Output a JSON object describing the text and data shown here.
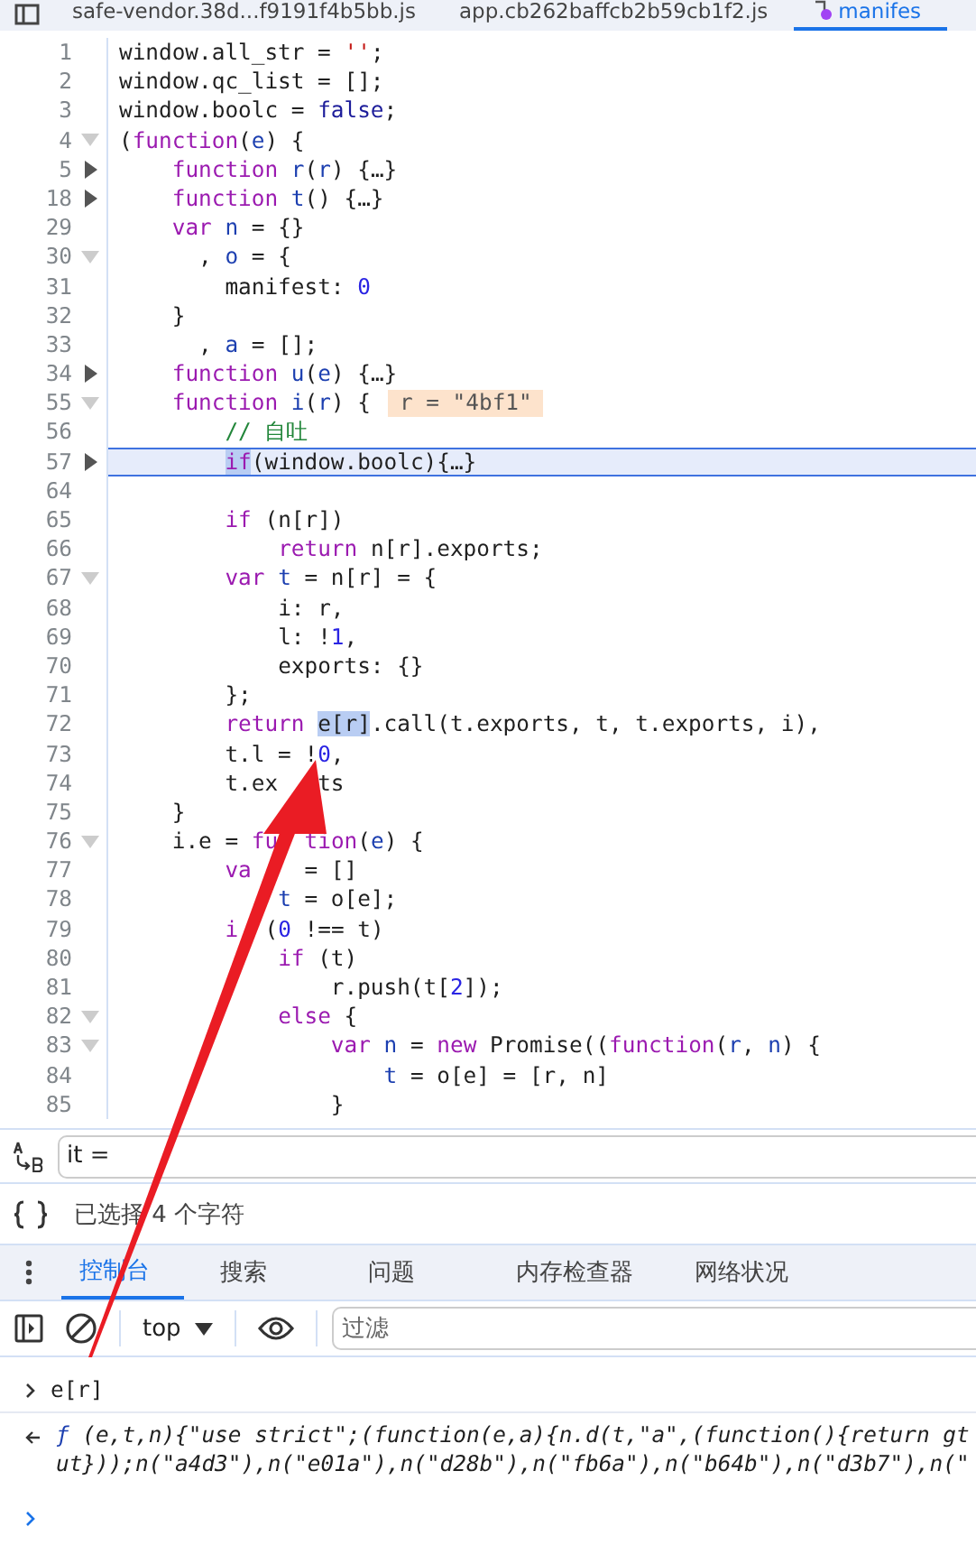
{
  "file_tabs": [
    {
      "label": "safe-vendor.38d...f9191f4b5bb.js",
      "selected": false
    },
    {
      "label": "app.cb262baffcb2b59cb1f2.js",
      "selected": false
    },
    {
      "label": "manifes",
      "selected": true
    }
  ],
  "code_lines": [
    {
      "num": "1",
      "segs": [
        {
          "t": "window.all_str = ",
          "kind": "plain"
        },
        {
          "t": "''",
          "kind": "string"
        },
        {
          "t": ";",
          "kind": "plain"
        }
      ]
    },
    {
      "num": "2",
      "segs": [
        {
          "t": "window.qc_list = [];",
          "kind": "plain"
        }
      ]
    },
    {
      "num": "3",
      "segs": [
        {
          "t": "window.boolc = ",
          "kind": "plain"
        },
        {
          "t": "false",
          "kind": "atom"
        },
        {
          "t": ";",
          "kind": "plain"
        }
      ]
    },
    {
      "num": "4",
      "expanded": true,
      "segs": [
        {
          "t": "(",
          "kind": "plain"
        },
        {
          "t": "function",
          "kind": "keyword"
        },
        {
          "t": "(",
          "kind": "plain"
        },
        {
          "t": "e",
          "kind": "var"
        },
        {
          "t": ") {",
          "kind": "plain"
        }
      ]
    },
    {
      "num": "5",
      "expanded": false,
      "segs": [
        {
          "t": "    function",
          "kind": "keyword"
        },
        {
          "t": " r",
          "kind": "var"
        },
        {
          "t": "(",
          "kind": "plain"
        },
        {
          "t": "r",
          "kind": "var"
        },
        {
          "t": ") {…}",
          "kind": "plain"
        }
      ]
    },
    {
      "num": "18",
      "expanded": false,
      "segs": [
        {
          "t": "    function",
          "kind": "keyword"
        },
        {
          "t": " t",
          "kind": "var"
        },
        {
          "t": "() {…}",
          "kind": "plain"
        }
      ]
    },
    {
      "num": "29",
      "segs": [
        {
          "t": "    var",
          "kind": "keyword"
        },
        {
          "t": " n",
          "kind": "var"
        },
        {
          "t": " = {}",
          "kind": "plain"
        }
      ]
    },
    {
      "num": "30",
      "expanded": true,
      "segs": [
        {
          "t": "      , ",
          "kind": "plain"
        },
        {
          "t": "o",
          "kind": "var"
        },
        {
          "t": " = {",
          "kind": "plain"
        }
      ]
    },
    {
      "num": "31",
      "segs": [
        {
          "t": "        manifest: ",
          "kind": "plain"
        },
        {
          "t": "0",
          "kind": "number"
        }
      ]
    },
    {
      "num": "32",
      "segs": [
        {
          "t": "    }",
          "kind": "plain"
        }
      ]
    },
    {
      "num": "33",
      "segs": [
        {
          "t": "      , ",
          "kind": "plain"
        },
        {
          "t": "a",
          "kind": "var"
        },
        {
          "t": " = [];",
          "kind": "plain"
        }
      ]
    },
    {
      "num": "34",
      "expanded": false,
      "segs": [
        {
          "t": "    function",
          "kind": "keyword"
        },
        {
          "t": " u",
          "kind": "var"
        },
        {
          "t": "(",
          "kind": "plain"
        },
        {
          "t": "e",
          "kind": "var"
        },
        {
          "t": ") {…}",
          "kind": "plain"
        }
      ]
    },
    {
      "num": "55",
      "expanded": true,
      "inline_value": "r = \"4bf1\"",
      "segs": [
        {
          "t": "    function",
          "kind": "keyword"
        },
        {
          "t": " i",
          "kind": "var"
        },
        {
          "t": "(",
          "kind": "plain"
        },
        {
          "t": "r",
          "kind": "var"
        },
        {
          "t": ") {",
          "kind": "plain"
        }
      ]
    },
    {
      "num": "56",
      "segs": [
        {
          "t": "        // 自吐",
          "kind": "comment"
        }
      ]
    },
    {
      "num": "57",
      "expanded": false,
      "current": true,
      "segs": [
        {
          "t": "        if",
          "kind": "keyword",
          "selected": true
        },
        {
          "t": "(window.boolc){…}",
          "kind": "plain"
        }
      ]
    },
    {
      "num": "64"
    },
    {
      "num": "65",
      "segs": [
        {
          "t": "        if",
          "kind": "keyword"
        },
        {
          "t": " (n[r])",
          "kind": "plain"
        }
      ]
    },
    {
      "num": "66",
      "segs": [
        {
          "t": "            return",
          "kind": "keyword"
        },
        {
          "t": " n[r].exports;",
          "kind": "plain"
        }
      ]
    },
    {
      "num": "67",
      "expanded": true,
      "segs": [
        {
          "t": "        var",
          "kind": "keyword"
        },
        {
          "t": " t",
          "kind": "var"
        },
        {
          "t": " = n[r] = {",
          "kind": "plain"
        }
      ]
    },
    {
      "num": "68",
      "segs": [
        {
          "t": "            i: r,",
          "kind": "plain"
        }
      ]
    },
    {
      "num": "69",
      "segs": [
        {
          "t": "            l: !",
          "kind": "plain"
        },
        {
          "t": "1",
          "kind": "number"
        },
        {
          "t": ",",
          "kind": "plain"
        }
      ]
    },
    {
      "num": "70",
      "segs": [
        {
          "t": "            exports: {}",
          "kind": "plain"
        }
      ]
    },
    {
      "num": "71",
      "segs": [
        {
          "t": "        };",
          "kind": "plain"
        }
      ]
    },
    {
      "num": "72",
      "segs": [
        {
          "t": "        return ",
          "kind": "keyword"
        },
        {
          "t": "e[r]",
          "kind": "plain",
          "selected": true
        },
        {
          "t": ".call(t.exports, t, t.exports, i),",
          "kind": "plain"
        }
      ]
    },
    {
      "num": "73",
      "segs": [
        {
          "t": "        t.l = !",
          "kind": "plain"
        },
        {
          "t": "0",
          "kind": "number"
        },
        {
          "t": ",",
          "kind": "plain"
        }
      ]
    },
    {
      "num": "74",
      "segs": [
        {
          "t": "        t.ex",
          "kind": "plain"
        },
        {
          "t": "   ts",
          "kind": "plain"
        }
      ]
    },
    {
      "num": "75",
      "segs": [
        {
          "t": "    }",
          "kind": "plain"
        }
      ]
    },
    {
      "num": "76",
      "expanded": true,
      "segs": [
        {
          "t": "    i.e = ",
          "kind": "plain"
        },
        {
          "t": "fu",
          "kind": "keyword"
        },
        {
          "t": "  tion",
          "kind": "keyword"
        },
        {
          "t": "(",
          "kind": "plain"
        },
        {
          "t": "e",
          "kind": "var"
        },
        {
          "t": ") {",
          "kind": "plain"
        }
      ]
    },
    {
      "num": "77",
      "segs": [
        {
          "t": "        va",
          "kind": "keyword"
        },
        {
          "t": "    = []",
          "kind": "plain"
        }
      ]
    },
    {
      "num": "78",
      "segs": [
        {
          "t": "            t",
          "kind": "var"
        },
        {
          "t": " = o[e];",
          "kind": "plain"
        }
      ]
    },
    {
      "num": "79",
      "segs": [
        {
          "t": "        i",
          "kind": "keyword"
        },
        {
          "t": "  (",
          "kind": "plain"
        },
        {
          "t": "0",
          "kind": "number"
        },
        {
          "t": " !== t)",
          "kind": "plain"
        }
      ]
    },
    {
      "num": "80",
      "segs": [
        {
          "t": "            if",
          "kind": "keyword"
        },
        {
          "t": " (t)",
          "kind": "plain"
        }
      ]
    },
    {
      "num": "81",
      "segs": [
        {
          "t": "                r.push(t[",
          "kind": "plain"
        },
        {
          "t": "2",
          "kind": "number"
        },
        {
          "t": "]);",
          "kind": "plain"
        }
      ]
    },
    {
      "num": "82",
      "expanded": true,
      "segs": [
        {
          "t": "            else",
          "kind": "keyword"
        },
        {
          "t": " {",
          "kind": "plain"
        }
      ]
    },
    {
      "num": "83",
      "expanded": true,
      "segs": [
        {
          "t": "                var",
          "kind": "keyword"
        },
        {
          "t": " n",
          "kind": "var"
        },
        {
          "t": " = ",
          "kind": "plain"
        },
        {
          "t": "new",
          "kind": "keyword"
        },
        {
          "t": " Promise((",
          "kind": "plain"
        },
        {
          "t": "function",
          "kind": "keyword"
        },
        {
          "t": "(",
          "kind": "plain"
        },
        {
          "t": "r",
          "kind": "var"
        },
        {
          "t": ", ",
          "kind": "plain"
        },
        {
          "t": "n",
          "kind": "var"
        },
        {
          "t": ") {",
          "kind": "plain"
        }
      ]
    },
    {
      "num": "84",
      "segs": [
        {
          "t": "                    t",
          "kind": "var"
        },
        {
          "t": " = o[e] = [r, n]",
          "kind": "plain"
        }
      ]
    },
    {
      "num": "85",
      "segs": [
        {
          "t": "                }",
          "kind": "plain"
        }
      ]
    }
  ],
  "search_bar": {
    "value": "it ="
  },
  "status": {
    "text": "已选择 4 个字符"
  },
  "drawer_tabs": [
    {
      "label": "控制台",
      "selected": true
    },
    {
      "label": "搜索",
      "selected": false
    },
    {
      "label": "问题",
      "selected": false
    },
    {
      "label": "内存检查器",
      "selected": false
    },
    {
      "label": "网络状况",
      "selected": false
    }
  ],
  "console_toolbar": {
    "context": "top",
    "filter_placeholder": "过滤"
  },
  "console": {
    "input": "e[r]",
    "result_prefix": "ƒ",
    "result_lines": [
      "(e,t,n){\"use strict\";(function(e,a){n.d(t,\"a\",(function(){return gt",
      "ut}));n(\"a4d3\"),n(\"e01a\"),n(\"d28b\"),n(\"fb6a\"),n(\"b64b\"),n(\"d3b7\"),n(\""
    ]
  }
}
